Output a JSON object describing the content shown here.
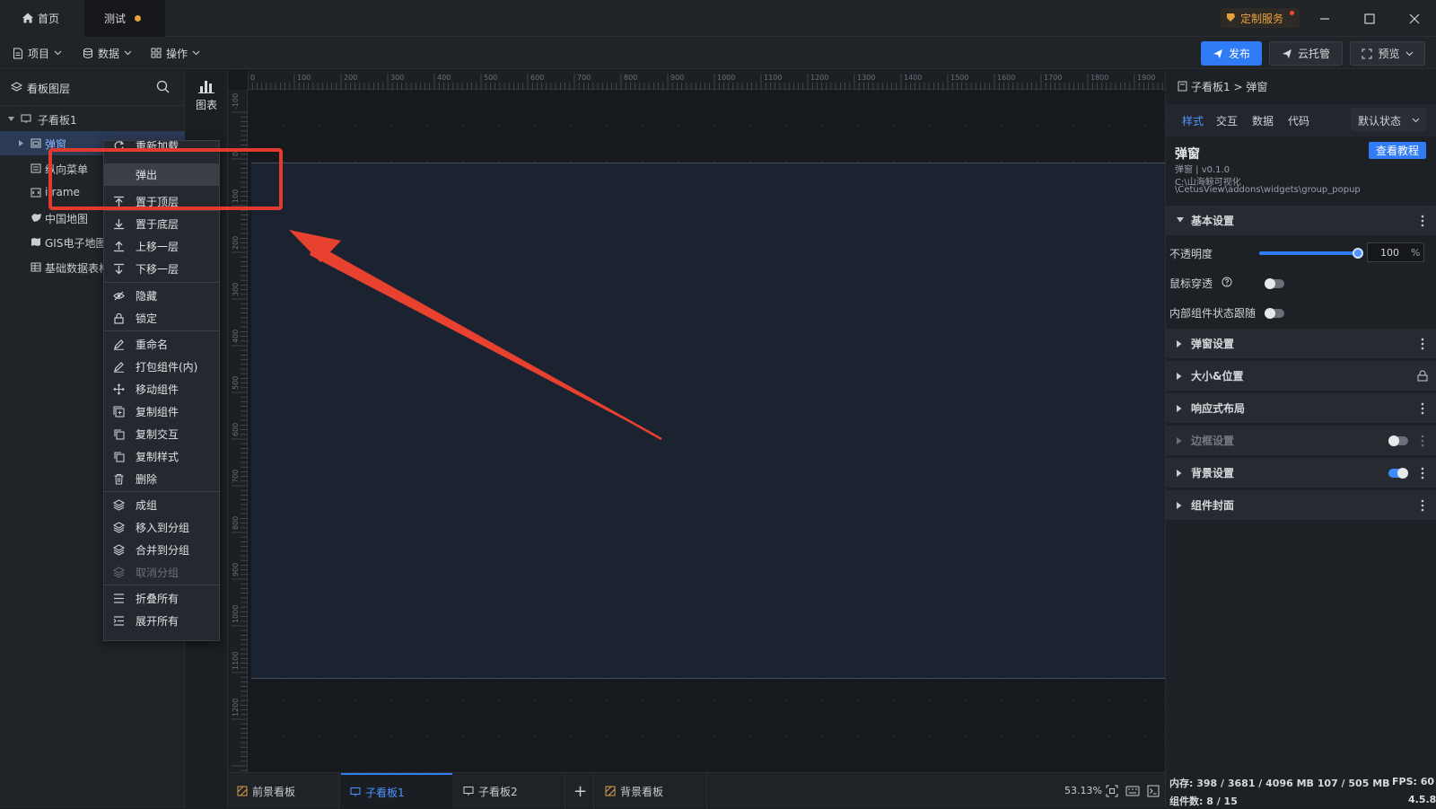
{
  "titlebar": {
    "tabs": [
      {
        "label": "首页"
      },
      {
        "label": "测试"
      }
    ],
    "add_tab": "+",
    "custom_service": "定制服务"
  },
  "toolbar": {
    "menus": [
      {
        "label": "项目"
      },
      {
        "label": "数据"
      },
      {
        "label": "操作"
      }
    ],
    "publish": "发布",
    "cloud": "云托管",
    "preview": "预览"
  },
  "left_panel": {
    "title": "看板图层",
    "chart_label": "图表",
    "layers": [
      {
        "label": "子看板1"
      },
      {
        "label": "弹窗"
      },
      {
        "label": "纵向菜单"
      },
      {
        "label": "iframe"
      },
      {
        "label": "中国地图"
      },
      {
        "label": "GIS电子地图"
      },
      {
        "label": "基础数据表格"
      }
    ]
  },
  "context_menu": {
    "items": [
      {
        "label": "重新加载"
      },
      {
        "label": "弹出"
      },
      {
        "label": "置于顶层"
      },
      {
        "label": "置于底层"
      },
      {
        "label": "上移一层"
      },
      {
        "label": "下移一层"
      },
      {
        "label": "隐藏"
      },
      {
        "label": "锁定"
      },
      {
        "label": "重命名"
      },
      {
        "label": "打包组件(内)"
      },
      {
        "label": "移动组件"
      },
      {
        "label": "复制组件"
      },
      {
        "label": "复制交互"
      },
      {
        "label": "复制样式"
      },
      {
        "label": "删除"
      },
      {
        "label": "成组"
      },
      {
        "label": "移入到分组"
      },
      {
        "label": "合并到分组"
      },
      {
        "label": "取消分组"
      },
      {
        "label": "折叠所有"
      },
      {
        "label": "展开所有"
      }
    ]
  },
  "canvas": {
    "ruler_top": [
      "0",
      "100",
      "200",
      "300",
      "400",
      "500",
      "600",
      "700",
      "800",
      "900",
      "1000",
      "1100",
      "1200",
      "1300",
      "1400",
      "1500",
      "1600",
      "1700",
      "1800",
      "1900"
    ],
    "ruler_left": [
      "-100",
      "0",
      "100",
      "200",
      "300",
      "400",
      "500",
      "600",
      "700",
      "800",
      "900",
      "1000",
      "1100",
      "1200"
    ]
  },
  "bottom_bar": {
    "tabs": [
      {
        "label": "前景看板"
      },
      {
        "label": "子看板1"
      },
      {
        "label": "子看板2"
      },
      {
        "label": "背景看板"
      }
    ],
    "add": "+",
    "zoom": "53.13%"
  },
  "right_panel": {
    "breadcrumb": "子看板1 > 弹窗",
    "tabs": [
      {
        "label": "样式"
      },
      {
        "label": "交互"
      },
      {
        "label": "数据"
      },
      {
        "label": "代码"
      }
    ],
    "state_select": "默认状态",
    "component_title": "弹窗",
    "component_version": "弹窗 | v0.1.0",
    "component_path_1": "C:\\山海鲸可视化",
    "component_path_2": "\\CetusView\\addons\\widgets\\group_popup",
    "tutorial_button": "查看教程",
    "basic_section": "基本设置",
    "opacity_label": "不透明度",
    "opacity_value": "100",
    "opacity_unit": "%",
    "opacity_level": 1.0,
    "mouse_through_label": "鼠标穿透",
    "inner_state_label": "内部组件状态跟随",
    "sections": [
      {
        "label": "弹窗设置"
      },
      {
        "label": "大小&位置"
      },
      {
        "label": "响应式布局"
      },
      {
        "label": "边框设置"
      },
      {
        "label": "背景设置"
      },
      {
        "label": "组件封面"
      }
    ]
  },
  "status": {
    "memory": "内存: 398 / 3681 / 4096 MB 107 / 505 MB",
    "fps": "FPS: 60",
    "components": "组件数: 8 / 15",
    "version": "4.5.8"
  },
  "colors": {
    "accent": "#2f7cf6",
    "highlight_box": "#e23b2e",
    "arrow": "#e8412f",
    "custom_service": "#e6a23c"
  }
}
